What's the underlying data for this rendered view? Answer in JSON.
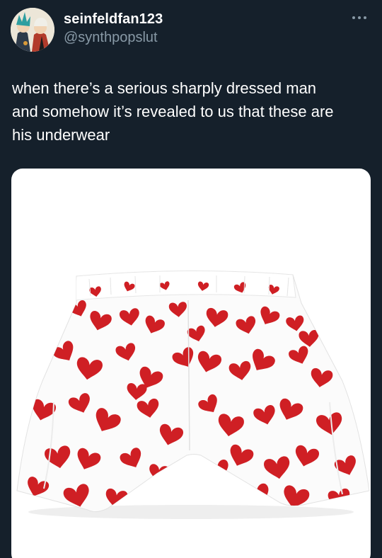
{
  "user": {
    "display_name": "seinfeldfan123",
    "handle": "@synthpopslut",
    "avatar_icon": "avatar-image"
  },
  "tweet": {
    "text": "when there’s a serious sharply dressed man\nand somehow it’s revealed to us that these are\nhis underwear"
  },
  "more_icon": "more-options-icon",
  "media": {
    "subject": "heart-print-boxer-shorts",
    "colors": {
      "heart": "#cf1f24",
      "fabric": "#fbfbfb",
      "background": "#ffffff"
    }
  },
  "theme": {
    "background": "#15202b",
    "primary_text": "#ffffff",
    "secondary_text": "#8899a6"
  }
}
